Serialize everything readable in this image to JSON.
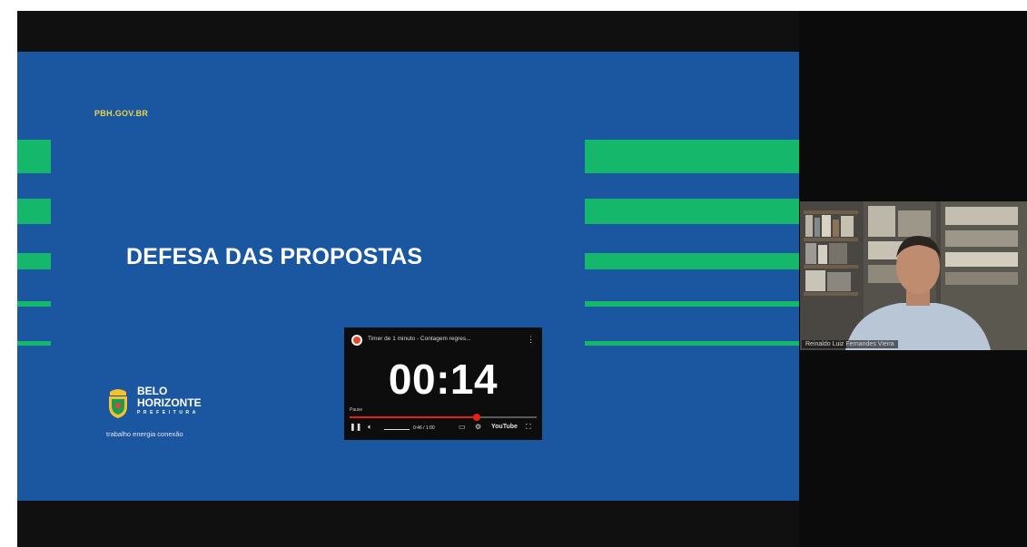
{
  "slide": {
    "site": "PBH.GOV.BR",
    "title": "DEFESA DAS PROPOSTAS",
    "colors": {
      "background": "#1b56a0",
      "stripe": "#15b86b",
      "site_text": "#e9d64a"
    }
  },
  "logo": {
    "line1": "BELO",
    "line2": "HORIZONTE",
    "line3": "PREFEITURA",
    "tagline": "trabalho energia conexão"
  },
  "timer_video": {
    "title": "Timer de 1 minuto - Contagem regres...",
    "menu_icon": "more-vertical-icon",
    "time": "00:14",
    "status": "Pause",
    "progress": 0.68,
    "time_display": "0:46 / 1:00",
    "youtube_label": "YouTube",
    "colors": {
      "accent": "#e62117"
    }
  },
  "participant": {
    "name": "Reinaldo Luiz Fernandes Vieira"
  }
}
